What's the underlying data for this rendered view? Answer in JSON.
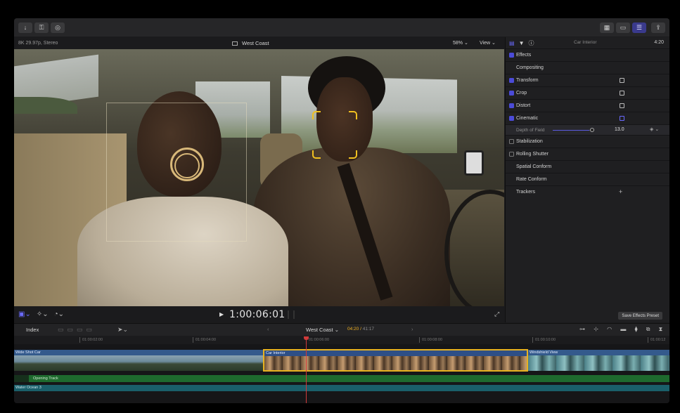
{
  "toolbar": {
    "left_icons": [
      "import-icon",
      "keywords-icon",
      "background-tasks-icon"
    ],
    "right_icons": [
      "browser-toggle-icon",
      "timeline-toggle-icon",
      "inspector-toggle-icon"
    ],
    "share_icon": "share-icon"
  },
  "viewer": {
    "format": "8K 29.97p, Stereo",
    "title": "West Coast",
    "zoom": "58%",
    "view_label": "View",
    "timecode": "1:00:06:01"
  },
  "inspector": {
    "clip_name": "Car Interior",
    "duration": "4:20",
    "rows": [
      {
        "label": "Effects",
        "checkbox": "on"
      },
      {
        "label": "Compositing",
        "checkbox": "none"
      },
      {
        "label": "Transform",
        "checkbox": "on",
        "icon": "transform-icon"
      },
      {
        "label": "Crop",
        "checkbox": "on",
        "icon": "crop-icon"
      },
      {
        "label": "Distort",
        "checkbox": "on",
        "icon": "distort-icon"
      },
      {
        "label": "Cinematic",
        "checkbox": "on",
        "icon": "camera-icon"
      }
    ],
    "depth_of_field": {
      "label": "Depth of Field",
      "value": "13.0",
      "fraction": 0.9
    },
    "rows2": [
      {
        "label": "Stabilization",
        "checkbox": "off"
      },
      {
        "label": "Rolling Shutter",
        "checkbox": "off"
      },
      {
        "label": "Spatial Conform",
        "checkbox": "none"
      },
      {
        "label": "Rate Conform",
        "checkbox": "none"
      },
      {
        "label": "Trackers",
        "checkbox": "none",
        "plus": "+"
      }
    ],
    "save_preset": "Save Effects Preset"
  },
  "timeline": {
    "index_label": "Index",
    "project": "West Coast",
    "position": "04:20",
    "total": "41:17",
    "ruler": [
      "01:00:02:00",
      "01:00:04:00",
      "01:00:06:00",
      "01:00:08:00",
      "01:00:10:00",
      "01:00:12"
    ],
    "clips": [
      "Wide Shot Car",
      "Car Interior",
      "Windshield View"
    ],
    "audio_tracks": [
      "Opening Track",
      "Water Ocean 3"
    ]
  },
  "colors": {
    "accent": "#4b4bd8",
    "selection": "#e8b220",
    "playhead": "#d23a3a"
  }
}
